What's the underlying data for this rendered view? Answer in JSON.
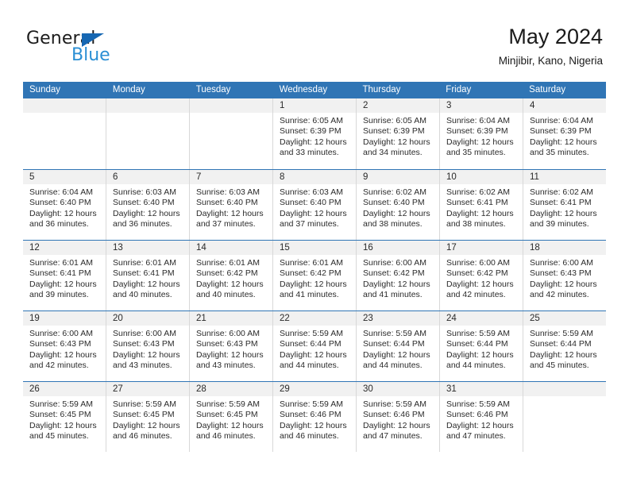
{
  "brand": {
    "word1": "General",
    "word2": "Blue",
    "triangle_color": "#1667b2",
    "blue_color": "#2b8fd4"
  },
  "header": {
    "title": "May 2024",
    "subtitle": "Minjibir, Kano, Nigeria",
    "header_bg": "#3075b5",
    "daynum_bg": "#f1f1f1"
  },
  "weekdays": [
    "Sunday",
    "Monday",
    "Tuesday",
    "Wednesday",
    "Thursday",
    "Friday",
    "Saturday"
  ],
  "weeks": [
    [
      {
        "day": "",
        "empty": true,
        "sunrise": "",
        "sunset": "",
        "daylight_a": "",
        "daylight_b": ""
      },
      {
        "day": "",
        "empty": true,
        "sunrise": "",
        "sunset": "",
        "daylight_a": "",
        "daylight_b": ""
      },
      {
        "day": "",
        "empty": true,
        "sunrise": "",
        "sunset": "",
        "daylight_a": "",
        "daylight_b": ""
      },
      {
        "day": "1",
        "sunrise": "Sunrise: 6:05 AM",
        "sunset": "Sunset: 6:39 PM",
        "daylight_a": "Daylight: 12 hours",
        "daylight_b": "and 33 minutes."
      },
      {
        "day": "2",
        "sunrise": "Sunrise: 6:05 AM",
        "sunset": "Sunset: 6:39 PM",
        "daylight_a": "Daylight: 12 hours",
        "daylight_b": "and 34 minutes."
      },
      {
        "day": "3",
        "sunrise": "Sunrise: 6:04 AM",
        "sunset": "Sunset: 6:39 PM",
        "daylight_a": "Daylight: 12 hours",
        "daylight_b": "and 35 minutes."
      },
      {
        "day": "4",
        "sunrise": "Sunrise: 6:04 AM",
        "sunset": "Sunset: 6:39 PM",
        "daylight_a": "Daylight: 12 hours",
        "daylight_b": "and 35 minutes."
      }
    ],
    [
      {
        "day": "5",
        "sunrise": "Sunrise: 6:04 AM",
        "sunset": "Sunset: 6:40 PM",
        "daylight_a": "Daylight: 12 hours",
        "daylight_b": "and 36 minutes."
      },
      {
        "day": "6",
        "sunrise": "Sunrise: 6:03 AM",
        "sunset": "Sunset: 6:40 PM",
        "daylight_a": "Daylight: 12 hours",
        "daylight_b": "and 36 minutes."
      },
      {
        "day": "7",
        "sunrise": "Sunrise: 6:03 AM",
        "sunset": "Sunset: 6:40 PM",
        "daylight_a": "Daylight: 12 hours",
        "daylight_b": "and 37 minutes."
      },
      {
        "day": "8",
        "sunrise": "Sunrise: 6:03 AM",
        "sunset": "Sunset: 6:40 PM",
        "daylight_a": "Daylight: 12 hours",
        "daylight_b": "and 37 minutes."
      },
      {
        "day": "9",
        "sunrise": "Sunrise: 6:02 AM",
        "sunset": "Sunset: 6:40 PM",
        "daylight_a": "Daylight: 12 hours",
        "daylight_b": "and 38 minutes."
      },
      {
        "day": "10",
        "sunrise": "Sunrise: 6:02 AM",
        "sunset": "Sunset: 6:41 PM",
        "daylight_a": "Daylight: 12 hours",
        "daylight_b": "and 38 minutes."
      },
      {
        "day": "11",
        "sunrise": "Sunrise: 6:02 AM",
        "sunset": "Sunset: 6:41 PM",
        "daylight_a": "Daylight: 12 hours",
        "daylight_b": "and 39 minutes."
      }
    ],
    [
      {
        "day": "12",
        "sunrise": "Sunrise: 6:01 AM",
        "sunset": "Sunset: 6:41 PM",
        "daylight_a": "Daylight: 12 hours",
        "daylight_b": "and 39 minutes."
      },
      {
        "day": "13",
        "sunrise": "Sunrise: 6:01 AM",
        "sunset": "Sunset: 6:41 PM",
        "daylight_a": "Daylight: 12 hours",
        "daylight_b": "and 40 minutes."
      },
      {
        "day": "14",
        "sunrise": "Sunrise: 6:01 AM",
        "sunset": "Sunset: 6:42 PM",
        "daylight_a": "Daylight: 12 hours",
        "daylight_b": "and 40 minutes."
      },
      {
        "day": "15",
        "sunrise": "Sunrise: 6:01 AM",
        "sunset": "Sunset: 6:42 PM",
        "daylight_a": "Daylight: 12 hours",
        "daylight_b": "and 41 minutes."
      },
      {
        "day": "16",
        "sunrise": "Sunrise: 6:00 AM",
        "sunset": "Sunset: 6:42 PM",
        "daylight_a": "Daylight: 12 hours",
        "daylight_b": "and 41 minutes."
      },
      {
        "day": "17",
        "sunrise": "Sunrise: 6:00 AM",
        "sunset": "Sunset: 6:42 PM",
        "daylight_a": "Daylight: 12 hours",
        "daylight_b": "and 42 minutes."
      },
      {
        "day": "18",
        "sunrise": "Sunrise: 6:00 AM",
        "sunset": "Sunset: 6:43 PM",
        "daylight_a": "Daylight: 12 hours",
        "daylight_b": "and 42 minutes."
      }
    ],
    [
      {
        "day": "19",
        "sunrise": "Sunrise: 6:00 AM",
        "sunset": "Sunset: 6:43 PM",
        "daylight_a": "Daylight: 12 hours",
        "daylight_b": "and 42 minutes."
      },
      {
        "day": "20",
        "sunrise": "Sunrise: 6:00 AM",
        "sunset": "Sunset: 6:43 PM",
        "daylight_a": "Daylight: 12 hours",
        "daylight_b": "and 43 minutes."
      },
      {
        "day": "21",
        "sunrise": "Sunrise: 6:00 AM",
        "sunset": "Sunset: 6:43 PM",
        "daylight_a": "Daylight: 12 hours",
        "daylight_b": "and 43 minutes."
      },
      {
        "day": "22",
        "sunrise": "Sunrise: 5:59 AM",
        "sunset": "Sunset: 6:44 PM",
        "daylight_a": "Daylight: 12 hours",
        "daylight_b": "and 44 minutes."
      },
      {
        "day": "23",
        "sunrise": "Sunrise: 5:59 AM",
        "sunset": "Sunset: 6:44 PM",
        "daylight_a": "Daylight: 12 hours",
        "daylight_b": "and 44 minutes."
      },
      {
        "day": "24",
        "sunrise": "Sunrise: 5:59 AM",
        "sunset": "Sunset: 6:44 PM",
        "daylight_a": "Daylight: 12 hours",
        "daylight_b": "and 44 minutes."
      },
      {
        "day": "25",
        "sunrise": "Sunrise: 5:59 AM",
        "sunset": "Sunset: 6:44 PM",
        "daylight_a": "Daylight: 12 hours",
        "daylight_b": "and 45 minutes."
      }
    ],
    [
      {
        "day": "26",
        "sunrise": "Sunrise: 5:59 AM",
        "sunset": "Sunset: 6:45 PM",
        "daylight_a": "Daylight: 12 hours",
        "daylight_b": "and 45 minutes."
      },
      {
        "day": "27",
        "sunrise": "Sunrise: 5:59 AM",
        "sunset": "Sunset: 6:45 PM",
        "daylight_a": "Daylight: 12 hours",
        "daylight_b": "and 46 minutes."
      },
      {
        "day": "28",
        "sunrise": "Sunrise: 5:59 AM",
        "sunset": "Sunset: 6:45 PM",
        "daylight_a": "Daylight: 12 hours",
        "daylight_b": "and 46 minutes."
      },
      {
        "day": "29",
        "sunrise": "Sunrise: 5:59 AM",
        "sunset": "Sunset: 6:46 PM",
        "daylight_a": "Daylight: 12 hours",
        "daylight_b": "and 46 minutes."
      },
      {
        "day": "30",
        "sunrise": "Sunrise: 5:59 AM",
        "sunset": "Sunset: 6:46 PM",
        "daylight_a": "Daylight: 12 hours",
        "daylight_b": "and 47 minutes."
      },
      {
        "day": "31",
        "sunrise": "Sunrise: 5:59 AM",
        "sunset": "Sunset: 6:46 PM",
        "daylight_a": "Daylight: 12 hours",
        "daylight_b": "and 47 minutes."
      },
      {
        "day": "",
        "empty": true,
        "sunrise": "",
        "sunset": "",
        "daylight_a": "",
        "daylight_b": ""
      }
    ]
  ]
}
